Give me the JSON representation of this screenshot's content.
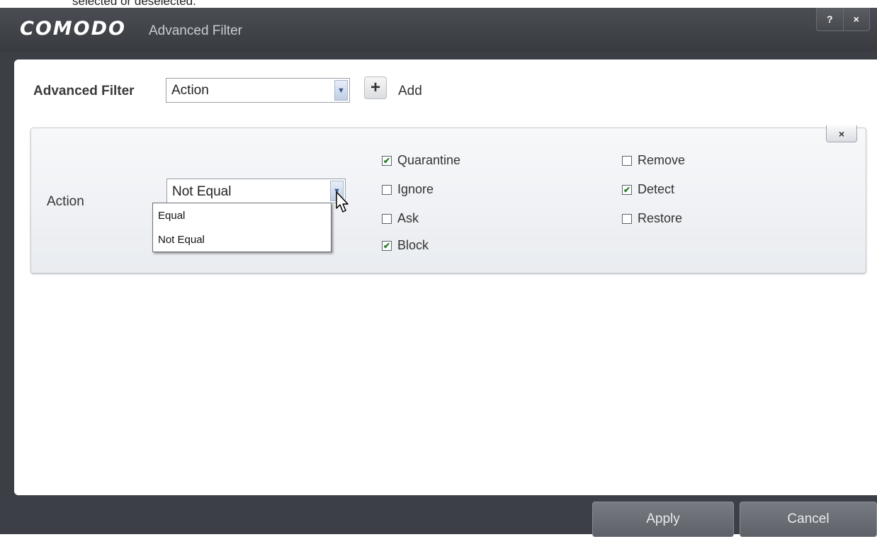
{
  "doc_fragment": "selected or deselected.",
  "window": {
    "logo": "COMODO",
    "title": "Advanced Filter",
    "help_label": "?",
    "close_label": "×"
  },
  "filter": {
    "label": "Advanced Filter",
    "selected": "Action",
    "add_label": "Add"
  },
  "condition": {
    "field_label": "Action",
    "operator_value": "Not Equal",
    "operator_options": [
      "Equal",
      "Not Equal"
    ],
    "remove_label": "×",
    "options": [
      {
        "label": "Quarantine",
        "checked": true
      },
      {
        "label": "Ignore",
        "checked": false
      },
      {
        "label": "Ask",
        "checked": false
      },
      {
        "label": "Block",
        "checked": true
      },
      {
        "label": "Remove",
        "checked": false
      },
      {
        "label": "Detect",
        "checked": true
      },
      {
        "label": "Restore",
        "checked": false
      }
    ]
  },
  "buttons": {
    "apply": "Apply",
    "cancel": "Cancel"
  }
}
